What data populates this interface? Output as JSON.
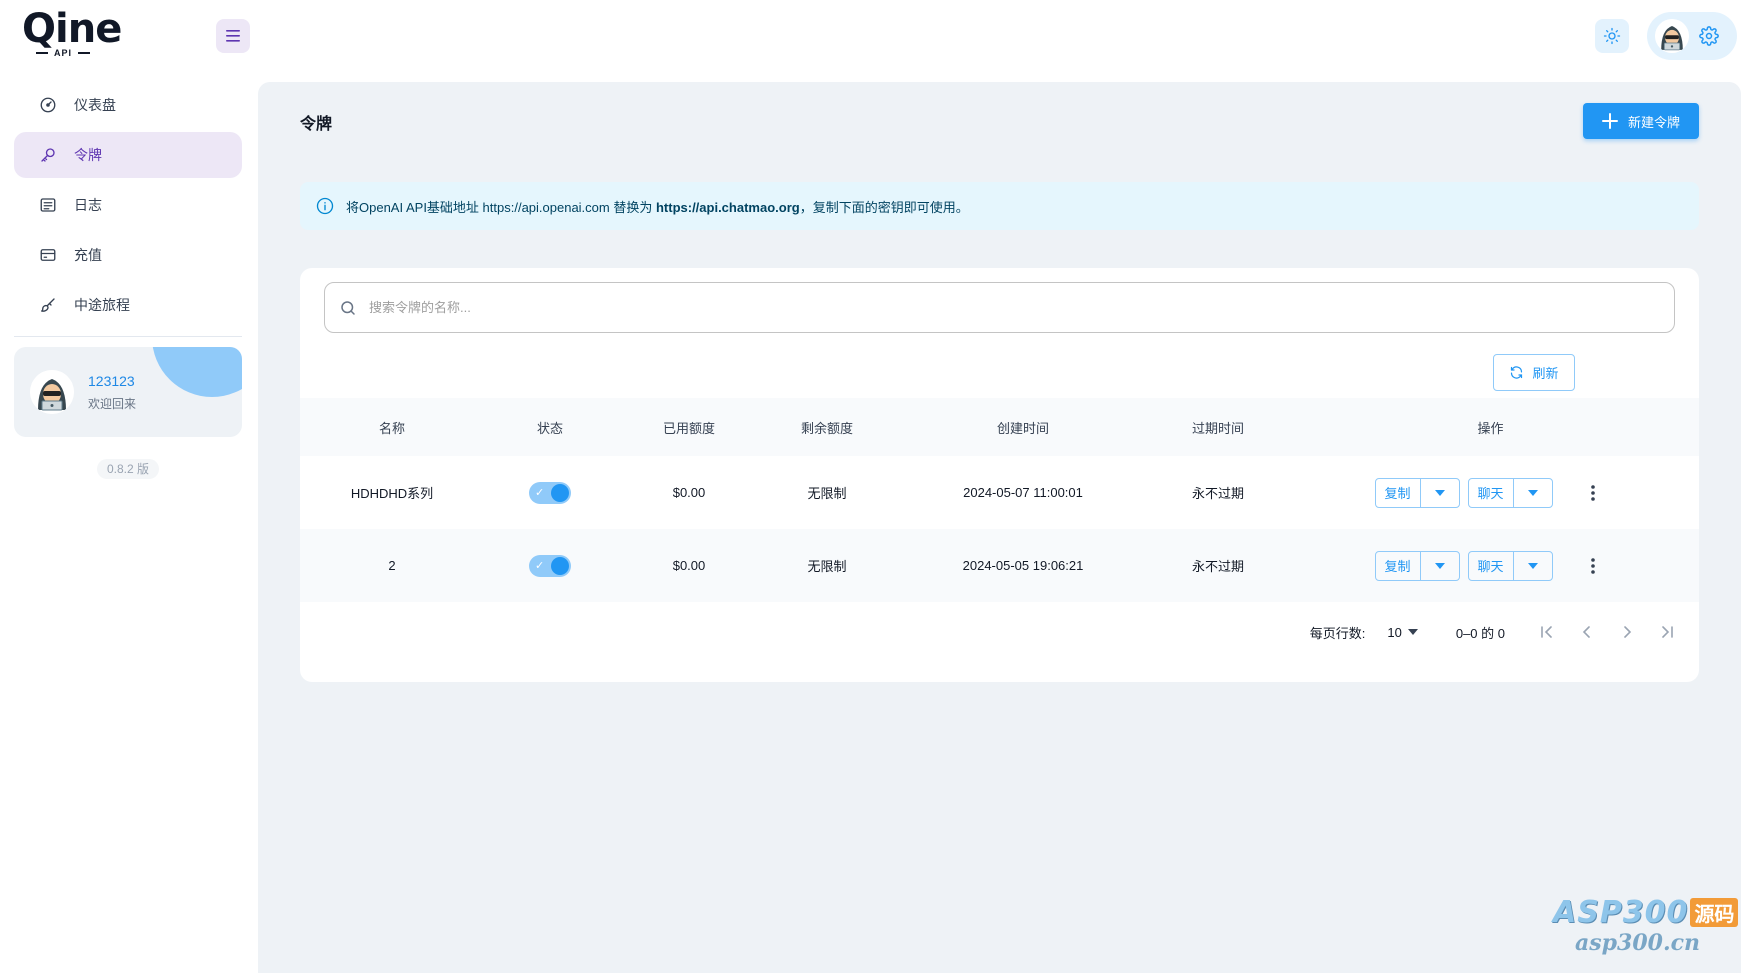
{
  "brand": {
    "logo_text": "Qine",
    "logo_sub": "API"
  },
  "icons": {
    "menu": "hamburger-icon",
    "theme": "sun-icon",
    "settings": "gear-icon",
    "search": "search-icon",
    "refresh": "refresh-icon",
    "info": "info-icon",
    "plus": "plus-icon"
  },
  "sidebar": {
    "items": [
      {
        "label": "仪表盘",
        "icon": "dashboard-icon",
        "active": false
      },
      {
        "label": "令牌",
        "icon": "key-icon",
        "active": true
      },
      {
        "label": "日志",
        "icon": "log-icon",
        "active": false
      },
      {
        "label": "充值",
        "icon": "credit-card-icon",
        "active": false
      },
      {
        "label": "中途旅程",
        "icon": "brush-icon",
        "active": false
      }
    ],
    "user": {
      "name": "123123",
      "welcome": "欢迎回来"
    },
    "version": "0.8.2 版"
  },
  "main": {
    "title": "令牌",
    "new_button": "新建令牌",
    "alert": {
      "prefix": "将OpenAI API基础地址 https://api.openai.com 替换为 ",
      "highlight": "https://api.chatmao.org",
      "suffix": "，复制下面的密钥即可使用。"
    },
    "search": {
      "placeholder": "搜索令牌的名称..."
    },
    "refresh_label": "刷新",
    "table": {
      "columns": [
        "名称",
        "状态",
        "已用额度",
        "剩余额度",
        "创建时间",
        "过期时间",
        "操作"
      ],
      "rows": [
        {
          "name": "HDHDHD系列",
          "enabled": true,
          "used": "$0.00",
          "remaining": "无限制",
          "created": "2024-05-07 11:00:01",
          "expires": "永不过期",
          "copy": "复制",
          "chat": "聊天"
        },
        {
          "name": "2",
          "enabled": true,
          "used": "$0.00",
          "remaining": "无限制",
          "created": "2024-05-05 19:06:21",
          "expires": "永不过期",
          "copy": "复制",
          "chat": "聊天"
        }
      ]
    },
    "pagination": {
      "rows_per_page_label": "每页行数:",
      "rows_per_page": "10",
      "range": "0–0 的 0"
    }
  },
  "watermark": {
    "brand": "ASP300",
    "badge": "源码",
    "url": "asp300.cn"
  },
  "colors": {
    "primary": "#2196f3",
    "secondary": "#5e35b1",
    "main_bg": "#eef2f6",
    "alert_bg": "#e5f6fd"
  }
}
